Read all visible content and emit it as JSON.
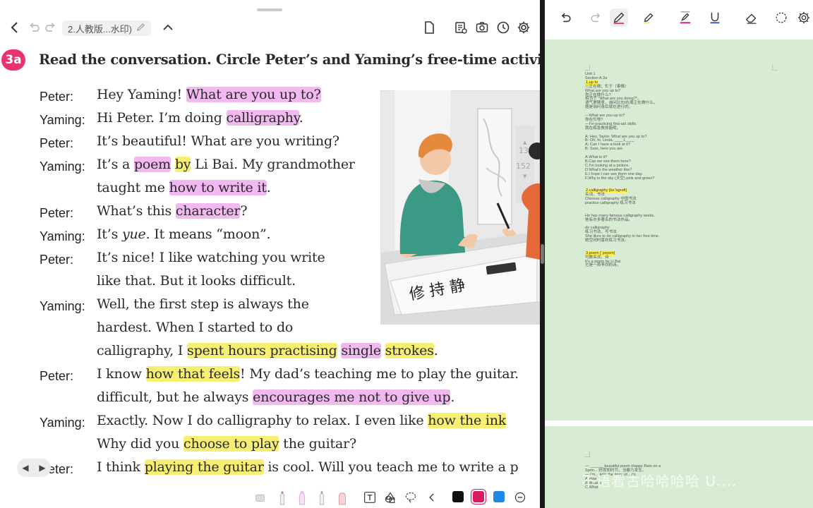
{
  "left": {
    "doc_title": "2.人教版...水印)",
    "badge": "3a",
    "instruction": "Read the conversation. Circle Peter’s and Yaming’s free-time activities.",
    "illustration": {
      "numbers": [
        "13",
        "152"
      ],
      "chars": "修 持 静"
    },
    "lines": [
      {
        "speaker": "Peter:",
        "parts": [
          {
            "t": "Hey Yaming! "
          },
          {
            "t": "What are you up to?",
            "h": "p"
          }
        ]
      },
      {
        "speaker": "Yaming:",
        "parts": [
          {
            "t": "Hi Peter. I’m doing "
          },
          {
            "t": "calligraphy",
            "h": "p"
          },
          {
            "t": "."
          }
        ]
      },
      {
        "speaker": "Peter:",
        "parts": [
          {
            "t": "It’s beautiful! What are you writing?"
          }
        ]
      },
      {
        "speaker": "Yaming:",
        "parts": [
          {
            "t": "It’s a "
          },
          {
            "t": "poem",
            "h": "p"
          },
          {
            "t": " "
          },
          {
            "t": "by",
            "h": "y"
          },
          {
            "t": " Li Bai. My grandmother"
          }
        ]
      },
      {
        "speaker": "",
        "parts": [
          {
            "t": "taught me "
          },
          {
            "t": "how to write it",
            "h": "p"
          },
          {
            "t": "."
          }
        ]
      },
      {
        "speaker": "Peter:",
        "parts": [
          {
            "t": "What’s this "
          },
          {
            "t": "character",
            "h": "p"
          },
          {
            "t": "?"
          }
        ]
      },
      {
        "speaker": "Yaming:",
        "parts": [
          {
            "t": "It’s "
          },
          {
            "t": "yue",
            "i": true
          },
          {
            "t": ". It means “moon”."
          }
        ]
      },
      {
        "speaker": "Peter:",
        "parts": [
          {
            "t": "It’s nice! I like watching you write"
          }
        ]
      },
      {
        "speaker": "",
        "parts": [
          {
            "t": "like that. But it looks difficult."
          }
        ]
      },
      {
        "speaker": "Yaming:",
        "parts": [
          {
            "t": "Well, the first step is always the"
          }
        ]
      },
      {
        "speaker": "",
        "parts": [
          {
            "t": "hardest. When I started to do"
          }
        ]
      },
      {
        "speaker": "",
        "parts": [
          {
            "t": "calligraphy, I "
          },
          {
            "t": "spent hours practising",
            "h": "y"
          },
          {
            "t": " "
          },
          {
            "t": "single",
            "h": "p"
          },
          {
            "t": " "
          },
          {
            "t": "strokes",
            "h": "y"
          },
          {
            "t": "."
          }
        ]
      },
      {
        "speaker": "Peter:",
        "parts": [
          {
            "t": "I know "
          },
          {
            "t": "how that feels",
            "h": "y"
          },
          {
            "t": "! My dad’s teaching me to play the guitar."
          }
        ]
      },
      {
        "speaker": "",
        "parts": [
          {
            "t": "difficult, but he always "
          },
          {
            "t": "encourages me not to give up",
            "h": "p"
          },
          {
            "t": "."
          }
        ]
      },
      {
        "speaker": "Yaming:",
        "parts": [
          {
            "t": "Exactly. Now I do calligraphy to relax. I even like "
          },
          {
            "t": "how the ink",
            "h": "y"
          }
        ]
      },
      {
        "speaker": "",
        "parts": [
          {
            "t": "Why did you "
          },
          {
            "t": "choose to play",
            "h": "y"
          },
          {
            "t": " the guitar?"
          }
        ]
      },
      {
        "speaker": "Peter:",
        "parts": [
          {
            "t": "I think "
          },
          {
            "t": "playing the guitar",
            "h": "y"
          },
          {
            "t": " is cool. Will you teach me to write a p"
          }
        ]
      }
    ]
  },
  "colors": {
    "pink_highlight": "#f2b8f0",
    "yellow_highlight": "#f7ef73",
    "badge": "#e8336e",
    "notes_bg": "#d7ecd2",
    "pen_black": "#111111",
    "pen_magenta": "#d81b60",
    "pen_blue": "#1e88e5"
  },
  "icons": {
    "topbar": [
      "back-icon",
      "undo-icon",
      "redo-icon",
      "edit-pencil-icon",
      "chevron-up-icon",
      "page-icon",
      "bookmark-list-icon",
      "camera-icon",
      "clock-icon",
      "settings-icon"
    ],
    "bottombar": [
      "eraser-tool-icon",
      "pen-red-icon",
      "highlighter-icon",
      "pen-blue-icon",
      "marker-icon",
      "text-tool-icon",
      "shapes-icon",
      "lasso-icon",
      "collapse-icon",
      "minus-icon"
    ],
    "right_toolbar": [
      "undo-icon",
      "redo-icon",
      "pen-icon",
      "highlighter-icon",
      "text-underline-icon",
      "underline-icon",
      "eraser-icon",
      "lasso-icon",
      "settings-icon"
    ]
  },
  "notes": {
    "page1": [
      {
        "t": "Unit 1"
      },
      {
        "t": "Section A 3a"
      },
      {
        "t": "1.up to",
        "hl": true
      },
      {
        "t": "①正在做；忙于（事情）"
      },
      {
        "t": "What are you up to?"
      },
      {
        "t": "你正在做什么?"
      },
      {
        "t": "相当于 \"What are you doing?\"。"
      },
      {
        "t": "语气更随意，询问比句/在周正在做什么，"
      },
      {
        "t": "题是询问身后就在进行的。"
      },
      {
        "t": ""
      },
      {
        "t": "—What are you up to?"
      },
      {
        "t": "你在忙啥?"
      },
      {
        "t": "—I'm practicing first-aid skills."
      },
      {
        "t": "我在练急救技能呢。"
      },
      {
        "t": ""
      },
      {
        "t": "A: Hey, Taylor. What are you up to?"
      },
      {
        "t": "B: Oh, hi, Linda. ____1____"
      },
      {
        "t": "A: Can I have a look at it?"
      },
      {
        "t": "B: Sure, here you are."
      },
      {
        "t": ""
      },
      {
        "t": "A.What is it?"
      },
      {
        "t": "B.Can we see them here?"
      },
      {
        "t": "C.I'm looking at a picture."
      },
      {
        "t": "D.What's the weather like?"
      },
      {
        "t": "E.I hope I can see them one day."
      },
      {
        "t": "F.Why is the sky (天空) pink and green?"
      },
      {
        "t": ""
      },
      {
        "t": ""
      },
      {
        "t": "2.calligraphy [kəˈlɪɡrəfi]",
        "hl": true
      },
      {
        "t": "名词，书法"
      },
      {
        "t": "Chinese calligraphy 中国书法"
      },
      {
        "t": "practice calligraphy 练习书法"
      },
      {
        "t": ""
      },
      {
        "t": ""
      },
      {
        "t": "He has many famous calligraphy works."
      },
      {
        "t": "他有许多著名的书法作品。"
      },
      {
        "t": ""
      },
      {
        "t": "do calligraphy"
      },
      {
        "t": "练习书法，写书法"
      },
      {
        "t": "She likes to do calligraphy in her free time."
      },
      {
        "t": "她空闲时喜欢练习书法。"
      },
      {
        "t": ""
      },
      {
        "t": ""
      },
      {
        "t": "3.poem [ˈpəʊɪm]",
        "hl": true
      },
      {
        "t": "可数名词，诗"
      },
      {
        "t": "It's a poem by Li Bai."
      },
      {
        "t": "它是一首李白的诗。"
      }
    ],
    "page2": [
      {
        "t": "— ______ beautiful poem Happy Rain on a"
      },
      {
        "t": "Sprin... 好雨知时节，当春乃发生。"
      },
      {
        "t": "— I'm... tells the story of... its"
      },
      {
        "t": "A.How"
      },
      {
        "t": "B.What a"
      },
      {
        "t": "C.What"
      }
    ]
  },
  "watermark": "不语看古哈哈哈哈 U...."
}
